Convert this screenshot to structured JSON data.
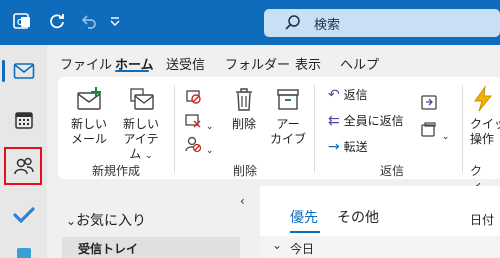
{
  "title_bar": {
    "search_placeholder": "検索"
  },
  "ribbon_tabs": [
    {
      "label": "ファイル"
    },
    {
      "label": "ホーム"
    },
    {
      "label": "送受信"
    },
    {
      "label": "フォルダー"
    },
    {
      "label": "表示"
    },
    {
      "label": "ヘルプ"
    }
  ],
  "ribbon": {
    "new_group": {
      "new_mail_line1": "新しい",
      "new_mail_line2": "メール",
      "new_item_line1": "新しい",
      "new_item_line2": "アイテム",
      "label": "新規作成"
    },
    "delete_group": {
      "delete": "削除",
      "archive_line1": "アー",
      "archive_line2": "カイブ",
      "label": "削除"
    },
    "respond_group": {
      "reply": "返信",
      "reply_all": "全員に返信",
      "forward": "転送",
      "label": "返信"
    },
    "quick_steps": {
      "line1": "クイッ",
      "line2": "操作",
      "label": "クイ…"
    }
  },
  "folder_pane": {
    "favorites": "お気に入り",
    "inbox": "受信トレイ"
  },
  "mail_list": {
    "tab_focused": "優先",
    "tab_other": "その他",
    "sort": "日付",
    "today_header": "今日"
  },
  "colors": {
    "accent": "#0f6cbd",
    "highlight_box": "#e0101c"
  }
}
